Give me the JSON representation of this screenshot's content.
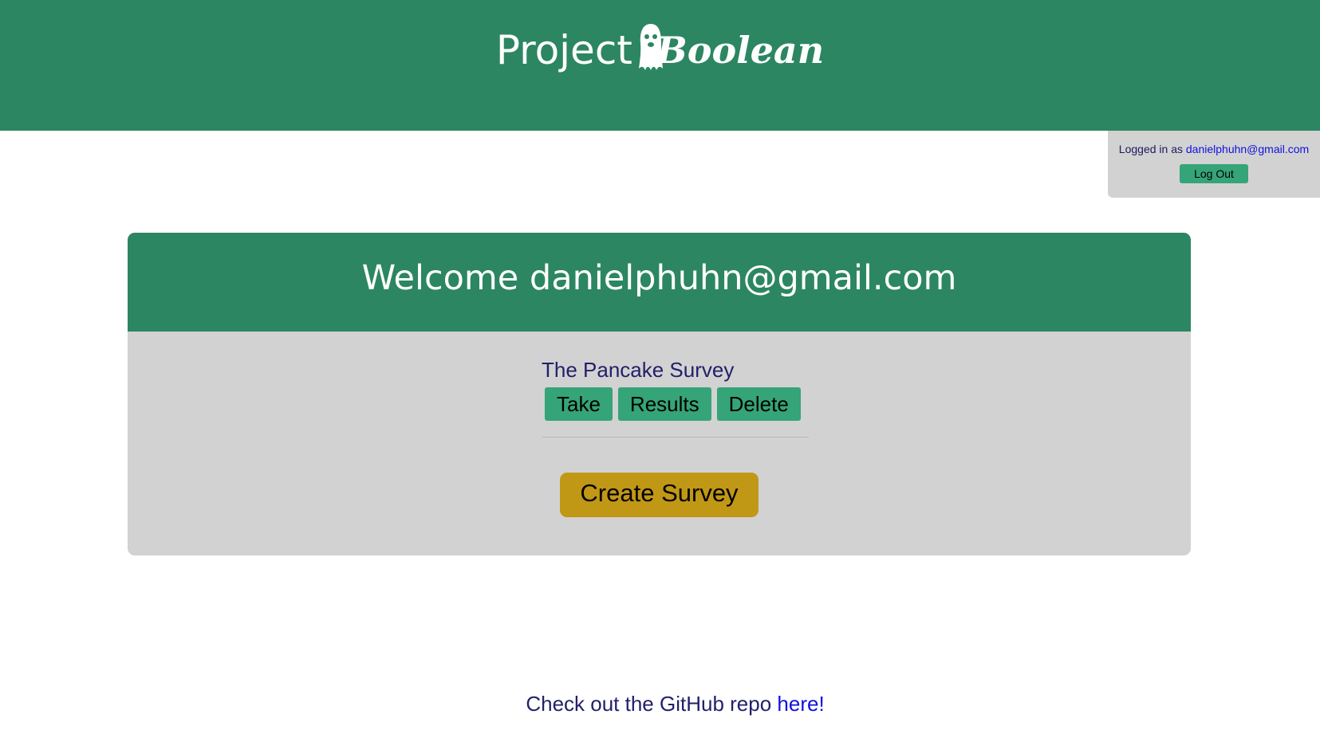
{
  "header": {
    "logo_word1": "Project",
    "logo_word2": "Boolean"
  },
  "login": {
    "prefix": "Logged in as",
    "email": "danielphuhn@gmail.com",
    "logout_label": "Log Out"
  },
  "welcome": {
    "title": "Welcome danielphuhn@gmail.com"
  },
  "surveys": [
    {
      "title": "The Pancake Survey",
      "take_label": "Take",
      "results_label": "Results",
      "delete_label": "Delete"
    }
  ],
  "create_label": "Create Survey",
  "footer": {
    "text": "Check out the GitHub repo",
    "link_label": "here!"
  },
  "colors": {
    "header_green": "#2c8662",
    "button_green": "#35a478",
    "panel_gray": "#d2d2d2",
    "create_gold": "#c19716",
    "text_navy": "#23206a",
    "link_blue": "#1010e0"
  }
}
